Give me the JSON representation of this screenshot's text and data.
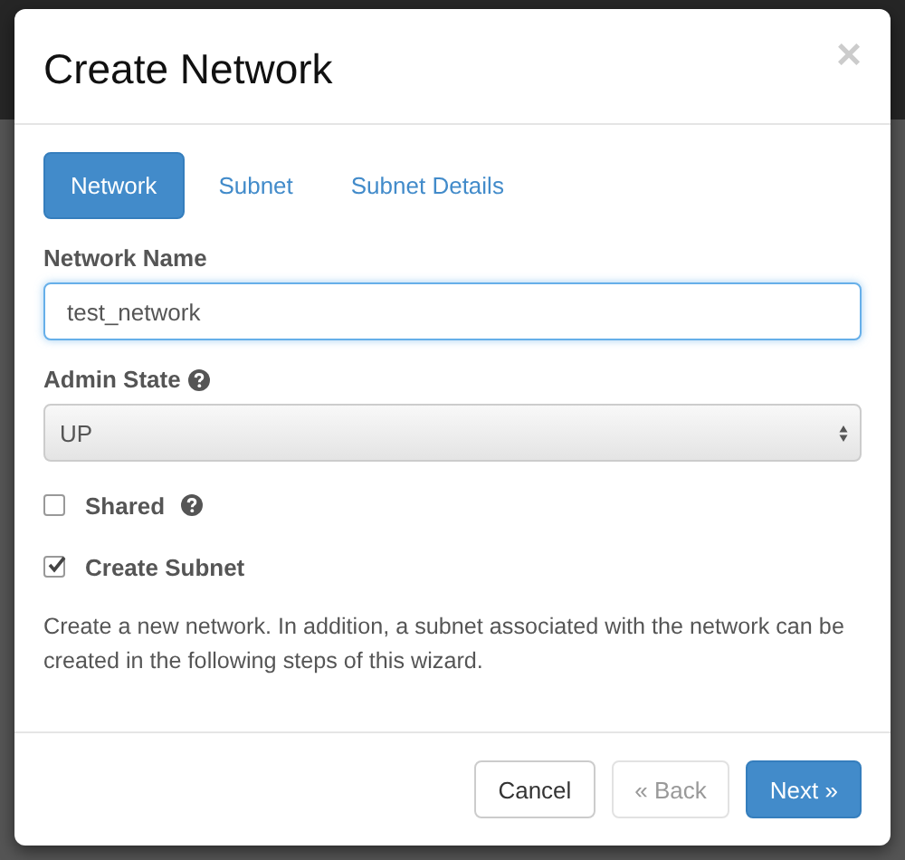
{
  "dialog": {
    "title": "Create Network",
    "close": "×"
  },
  "tabs": [
    {
      "label": "Network",
      "selected": true
    },
    {
      "label": "Subnet",
      "selected": false
    },
    {
      "label": "Subnet Details",
      "selected": false
    }
  ],
  "fields": [
    {
      "kind": "text",
      "label": "Network Name",
      "value": "test_network",
      "focused": true,
      "help": false
    },
    {
      "kind": "select",
      "label": "Admin State",
      "value": "UP",
      "help": true
    }
  ],
  "checkboxes": [
    {
      "label": "Shared",
      "checked": false,
      "help": true
    },
    {
      "label": "Create Subnet",
      "checked": true,
      "help": false
    }
  ],
  "description": "Create a new network. In addition, a subnet associated with the network can be created in the following steps of this wizard.",
  "buttons": [
    {
      "label": "Cancel",
      "kind": "default",
      "disabled": false
    },
    {
      "label": "« Back",
      "kind": "default",
      "disabled": true
    },
    {
      "label": "Next »",
      "kind": "primary",
      "disabled": false
    }
  ]
}
